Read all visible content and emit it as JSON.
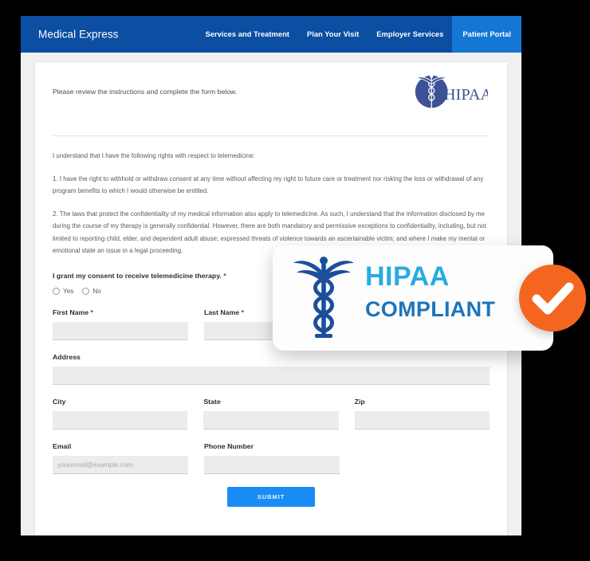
{
  "site": {
    "brand": "Medical Express",
    "nav": [
      {
        "label": "Services and Treatment",
        "active": false
      },
      {
        "label": "Plan Your Visit",
        "active": false
      },
      {
        "label": "Employer Services",
        "active": false
      },
      {
        "label": "Patient Portal",
        "active": true
      }
    ],
    "header_bg": "#0b4ea2",
    "active_tab_bg": "#1477d4"
  },
  "form": {
    "intro": "Please review the instructions and complete the form below.",
    "seal_text": "HIPAA",
    "paragraphs": {
      "lead": "I understand that I have the following rights with respect to telemedicine:",
      "item1": "1. I have the right to withhold or withdraw consent at any time without affecting my right to future care or treatment nor risking the loss or withdrawal of any program benefits to which I would otherwise be entitled.",
      "item2": "2. The laws that protect the confidentiality of my medical information also apply to telemedicine. As such, I understand that the information disclosed by me during the course of my therapy is generally confidential. However, there are both mandatory and permissive exceptions to confidentiality, including, but not limited to reporting child, elder, and dependent adult abuse; expressed threats of violence towards an ascertainable victim; and where I make my mental or emotional state an issue in a legal proceeding."
    },
    "consent": {
      "label": "I grant my consent to receive telemedicine therapy.",
      "required_mark": "*",
      "options": [
        {
          "label": "Yes",
          "selected": false
        },
        {
          "label": "No",
          "selected": false
        }
      ]
    },
    "fields": {
      "first_name": {
        "label": "First Name",
        "required_mark": "*",
        "value": "",
        "placeholder": ""
      },
      "last_name": {
        "label": "Last Name",
        "required_mark": "*",
        "value": "",
        "placeholder": ""
      },
      "address": {
        "label": "Address",
        "required_mark": "",
        "value": "",
        "placeholder": ""
      },
      "city": {
        "label": "City",
        "required_mark": "",
        "value": "",
        "placeholder": ""
      },
      "state": {
        "label": "State",
        "required_mark": "",
        "value": "",
        "placeholder": ""
      },
      "zip": {
        "label": "Zip",
        "required_mark": "",
        "value": "",
        "placeholder": ""
      },
      "email": {
        "label": "Email",
        "required_mark": "",
        "value": "",
        "placeholder": "youremail@example.com"
      },
      "phone": {
        "label": "Phone Number",
        "required_mark": "",
        "value": "",
        "placeholder": ""
      }
    },
    "submit_label": "SUBMIT"
  },
  "badge": {
    "line1": "HIPAA",
    "line2": "COMPLIANT",
    "line1_color": "#29abe2",
    "line2_color": "#1b75bc",
    "check_color": "#f4661f"
  }
}
